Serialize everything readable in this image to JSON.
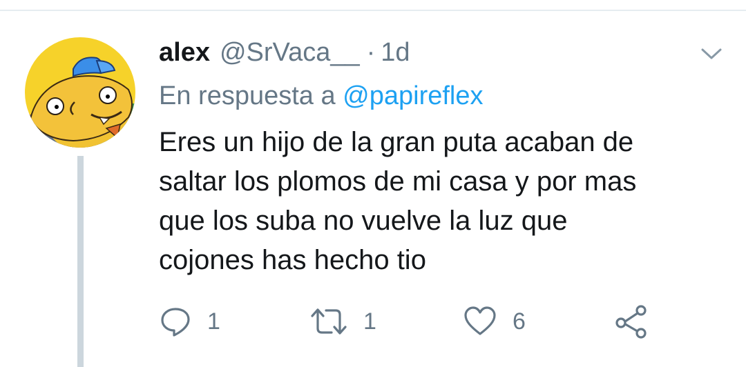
{
  "tweet": {
    "author_name": "alex",
    "author_handle": "@SrVaca__",
    "separator": "·",
    "timestamp": "1d",
    "reply_prefix": "En respuesta a",
    "reply_to_handle": "@papireflex",
    "text_lines": [
      "Eres un hijo de la gran puta acaban de",
      "saltar los plomos de mi casa y por mas",
      "que los suba no vuelve la luz que",
      "cojones has hecho tio"
    ],
    "reply_count": "1",
    "retweet_count": "1",
    "like_count": "6"
  },
  "colors": {
    "text": "#14171a",
    "secondary": "#657786",
    "link": "#1da1f2",
    "thread_line": "#ccd6dd",
    "divider": "#e6ecf0"
  },
  "icons": {
    "caret": "chevron-down-icon",
    "reply": "reply-icon",
    "retweet": "retweet-icon",
    "like": "heart-icon",
    "share": "share-icon"
  }
}
